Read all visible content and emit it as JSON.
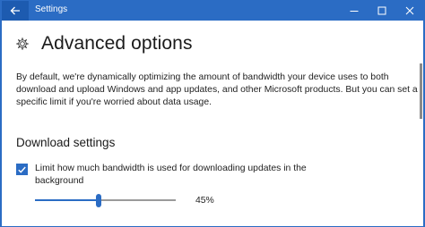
{
  "window": {
    "title": "Settings",
    "accent_color": "#2b6cc4",
    "controls": [
      "minimize-icon",
      "maximize-icon",
      "close-icon"
    ]
  },
  "header": {
    "icon": "gear-icon",
    "title": "Advanced options"
  },
  "description": "By default, we're dynamically optimizing the amount of bandwidth your device uses to both download and upload Windows and app updates, and other Microsoft products. But you can set a specific limit if you're worried about data usage.",
  "download_settings": {
    "title": "Download settings",
    "limit_checkbox": {
      "checked": true,
      "label": "Limit how much bandwidth is used for downloading updates in the background"
    },
    "bandwidth_slider": {
      "value_fraction": 0.45,
      "value_label": "45%"
    }
  }
}
